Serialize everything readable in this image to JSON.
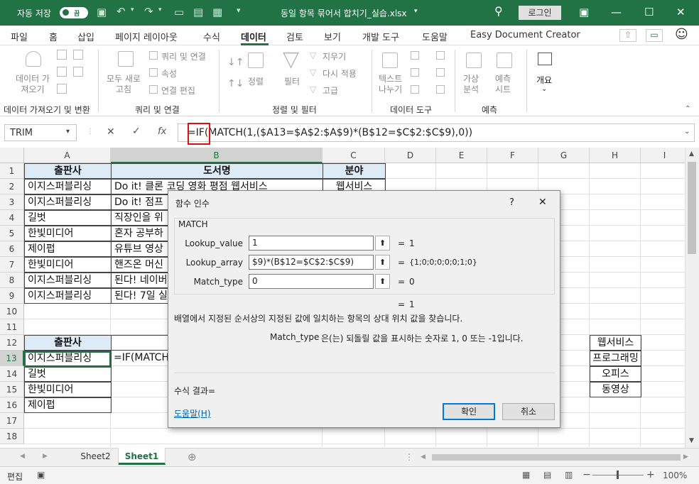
{
  "titlebar": {
    "autosave_label": "자동 저장",
    "toggle_state": "끔",
    "file_name": "동일 항목 묶어서 합치기_실습.xlsx",
    "login": "로그인",
    "colors": {
      "bg": "#217346"
    }
  },
  "menu": {
    "tabs": [
      "파일",
      "홈",
      "삽입",
      "페이지 레이아웃",
      "수식",
      "데이터",
      "검토",
      "보기",
      "개발 도구",
      "도움말",
      "Easy Document Creator"
    ],
    "active": "데이터"
  },
  "ribbon": {
    "get_data": "데이터 가\n져오기",
    "refresh_all": "모두 새로\n고침",
    "queries_connections": "쿼리 및 연결",
    "properties": "속성",
    "edit_links": "연결 편집",
    "sort": "정렬",
    "filter": "필터",
    "clear": "지우기",
    "reapply": "다시 적용",
    "advanced": "고급",
    "text_to_columns": "텍스트\n나누기",
    "what_if": "가상\n분석",
    "forecast_sheet": "예측\n시트",
    "outline": "개요",
    "groups": [
      "데이터 가져오기 및 변환",
      "쿼리 및 연결",
      "정렬 및 필터",
      "데이터 도구",
      "예측"
    ]
  },
  "formula_bar": {
    "name_box": "TRIM",
    "formula": "=IF(MATCH(1,($A13=$A$2:$A$9)*(B$12=$C$2:$C$9),0))"
  },
  "columns": [
    "A",
    "B",
    "C",
    "D",
    "E",
    "F",
    "G",
    "H",
    "I"
  ],
  "rows": [
    "1",
    "2",
    "3",
    "4",
    "5",
    "6",
    "7",
    "8",
    "9",
    "10",
    "11",
    "12",
    "13",
    "14",
    "15",
    "16",
    "17",
    "18"
  ],
  "table1": {
    "headers": [
      "출판사",
      "도서명",
      "분야"
    ],
    "rows": [
      [
        "이지스퍼블리싱",
        "Do it! 클론 코딩 영화 평점 웹서비스",
        "웹서비스"
      ],
      [
        "이지스퍼블리싱",
        "Do it! 점프",
        ""
      ],
      [
        "길벗",
        "직장인을 위",
        ""
      ],
      [
        "한빛미디어",
        "혼자 공부하",
        ""
      ],
      [
        "제이펍",
        "유튜브 영상",
        ""
      ],
      [
        "한빛미디어",
        "핸즈온 머신",
        ""
      ],
      [
        "이지스퍼블리싱",
        "된다! 네이버",
        ""
      ],
      [
        "이지스퍼블리싱",
        "된다! 7일 실",
        ""
      ]
    ]
  },
  "table2": {
    "header": "출판사",
    "rows": [
      "이지스퍼블리싱",
      "길벗",
      "한빛미디어",
      "제이펍"
    ],
    "b13": "=IF(MATCH"
  },
  "side_list": [
    "웹서비스",
    "프로그래밍",
    "오피스",
    "동영상"
  ],
  "dialog": {
    "title": "함수 인수",
    "help_mark": "?",
    "close": "✕",
    "function": "MATCH",
    "args": [
      {
        "label": "Lookup_value",
        "value": "1",
        "result": "1"
      },
      {
        "label": "Lookup_array",
        "value": "$9)*(B$12=$C$2:$C$9)",
        "result": "{1;0;0;0;0;0;1;0}"
      },
      {
        "label": "Match_type",
        "value": "0",
        "result": "0"
      }
    ],
    "eq": "=",
    "overall_result": "1",
    "description": "배열에서 지정된 순서상의 지정된 값에 일치하는 항목의 상대 위치 값을 찾습니다.",
    "arg_help_name": "Match_type",
    "arg_help_text": "은(는) 되돌릴 값을 표시하는 숫자로 1, 0 또는 -1입니다.",
    "formula_result_label": "수식 결과=",
    "help_link": "도움말(H)",
    "ok": "확인",
    "cancel": "취소"
  },
  "sheets": [
    "Sheet2",
    "Sheet1"
  ],
  "active_sheet": "Sheet1",
  "status": {
    "mode": "편집",
    "zoom": "100%"
  }
}
